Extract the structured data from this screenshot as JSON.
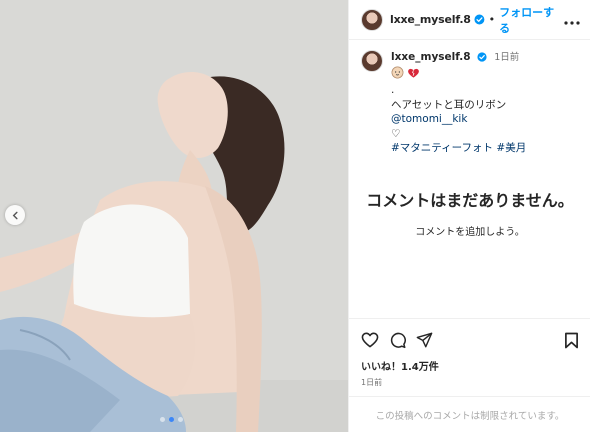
{
  "header": {
    "username": "lxxe_myself.8",
    "separator": "•",
    "follow_label": "フォローする"
  },
  "caption": {
    "username": "lxxe_myself.8",
    "time": "1日前",
    "dot_line": ".",
    "credit_text": "ヘアセットと耳のリボン ",
    "mention": "@tomomi__kik",
    "heart_line": "♡",
    "hashtags": [
      "#マタニティーフォト",
      "#美月"
    ]
  },
  "empty_comments": {
    "title": "コメントはまだありません。",
    "subtitle": "コメントを追加しよう。"
  },
  "stats": {
    "likes": "いいね！1.4万件",
    "posted": "1日前"
  },
  "comment_bar": {
    "text": "この投稿へのコメントは制限されています。"
  },
  "carousel": {
    "count": 3,
    "active_index": 1
  },
  "colors": {
    "accent": "#0095f6",
    "link": "#00376b",
    "muted": "#737373"
  }
}
